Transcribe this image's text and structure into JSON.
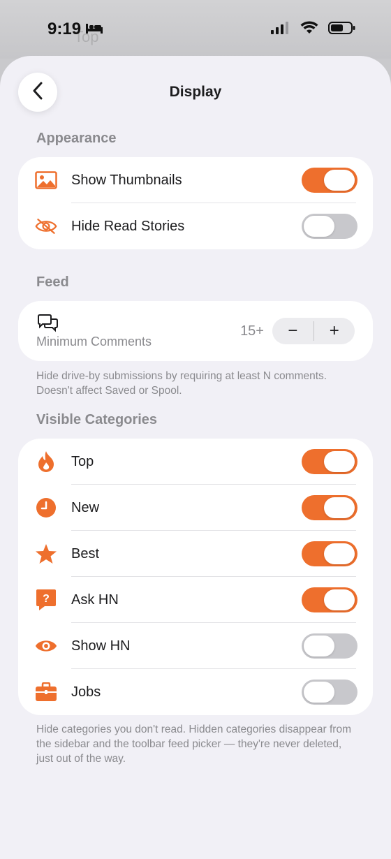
{
  "status": {
    "time": "9:19"
  },
  "background_peek": {
    "text": "Top"
  },
  "header": {
    "title": "Display"
  },
  "appearance": {
    "heading": "Appearance",
    "items": [
      {
        "label": "Show Thumbnails",
        "icon": "photo-icon",
        "on": true
      },
      {
        "label": "Hide Read Stories",
        "icon": "eye-slash-icon",
        "on": false
      }
    ]
  },
  "feed": {
    "heading": "Feed",
    "min_comments_label": "Minimum Comments",
    "min_comments_value": "15+",
    "minus": "−",
    "plus": "+",
    "footnote": "Hide drive-by submissions by requiring at least N comments. Doesn't affect Saved or Spool."
  },
  "categories": {
    "heading": "Visible Categories",
    "items": [
      {
        "label": "Top",
        "icon": "flame-icon",
        "on": true
      },
      {
        "label": "New",
        "icon": "clock-icon",
        "on": true
      },
      {
        "label": "Best",
        "icon": "star-icon",
        "on": true
      },
      {
        "label": "Ask HN",
        "icon": "question-bubble-icon",
        "on": true
      },
      {
        "label": "Show HN",
        "icon": "eye-icon",
        "on": false
      },
      {
        "label": "Jobs",
        "icon": "briefcase-icon",
        "on": false
      }
    ],
    "footnote": "Hide categories you don't read. Hidden categories disappear from the sidebar and the toolbar feed picker — they're never deleted, just out of the way."
  },
  "colors": {
    "accent": "#ee6f2d",
    "toggle_off": "#c8c8cc",
    "background": "#f1f0f6"
  }
}
